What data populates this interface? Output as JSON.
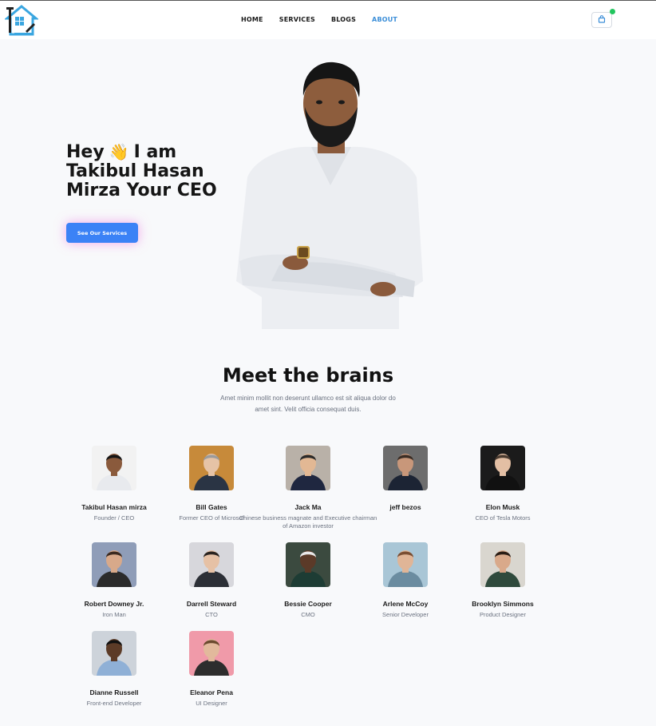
{
  "nav": {
    "links": [
      "HOME",
      "SERVICES",
      "BLOGS",
      "ABOUT"
    ],
    "active_index": 3,
    "accent_color": "#3b8ed8",
    "cart_icon": "shopping-bag-icon",
    "status_color": "#22c55e"
  },
  "hero": {
    "title_lines": [
      "Hey",
      "I am",
      "Takibul Hasan",
      "Mirza Your CEO"
    ],
    "wave_emoji": "👋",
    "cta_label": "See Our Services",
    "cta_color": "#3b82f6"
  },
  "team_section": {
    "title": "Meet the brains",
    "subtitle": "Amet minim mollit non deserunt ullamco est sit aliqua dolor do amet sint. Velit officia consequat duis."
  },
  "team": [
    {
      "name": "Takibul Hasan mirza",
      "role": "Founder / CEO"
    },
    {
      "name": "Bill Gates",
      "role": "Former CEO of Microsof"
    },
    {
      "name": "Jack Ma",
      "role": "Chinese business magnate and Executive chairman of Amazon investor"
    },
    {
      "name": "jeff bezos",
      "role": ""
    },
    {
      "name": "Elon Musk",
      "role": "CEO of Tesla Motors"
    },
    {
      "name": "Robert Downey Jr.",
      "role": "Iron Man"
    },
    {
      "name": "Darrell Steward",
      "role": "CTO"
    },
    {
      "name": "Bessie Cooper",
      "role": "CMO"
    },
    {
      "name": "Arlene McCoy",
      "role": "Senior Developer"
    },
    {
      "name": "Brooklyn Simmons",
      "role": "Product Designer"
    },
    {
      "name": "Dianne Russell",
      "role": "Front-end Developer"
    },
    {
      "name": "Eleanor Pena",
      "role": "UI Designer"
    }
  ]
}
